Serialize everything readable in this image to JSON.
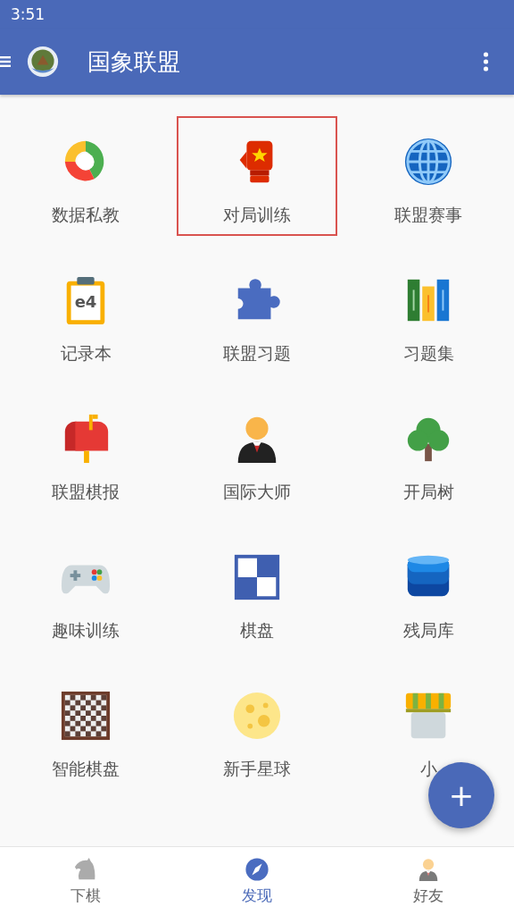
{
  "status_bar": {
    "time": "3:51"
  },
  "toolbar": {
    "title": "国象联盟"
  },
  "grid": [
    {
      "label": "数据私教",
      "kind": "donut",
      "selected": false
    },
    {
      "label": "对局训练",
      "kind": "glove",
      "selected": true
    },
    {
      "label": "联盟赛事",
      "kind": "globe",
      "selected": false
    },
    {
      "label": "记录本",
      "kind": "clipboard",
      "icon_text": "e4",
      "selected": false
    },
    {
      "label": "联盟习题",
      "kind": "puzzle",
      "selected": false
    },
    {
      "label": "习题集",
      "kind": "books",
      "selected": false
    },
    {
      "label": "联盟棋报",
      "kind": "mailbox",
      "selected": false
    },
    {
      "label": "国际大师",
      "kind": "person",
      "selected": false
    },
    {
      "label": "开局树",
      "kind": "tree",
      "selected": false
    },
    {
      "label": "趣味训练",
      "kind": "gamepad",
      "selected": false
    },
    {
      "label": "棋盘",
      "kind": "board",
      "selected": false
    },
    {
      "label": "残局库",
      "kind": "database",
      "selected": false
    },
    {
      "label": "智能棋盘",
      "kind": "checker",
      "selected": false
    },
    {
      "label": "新手星球",
      "kind": "moon",
      "selected": false
    },
    {
      "label": "小",
      "kind": "shop",
      "selected": false
    }
  ],
  "fab": {
    "symbol": "+"
  },
  "bottom_nav": [
    {
      "label": "下棋",
      "kind": "knight",
      "selected": false
    },
    {
      "label": "发现",
      "kind": "compass",
      "selected": true
    },
    {
      "label": "好友",
      "kind": "person",
      "selected": false
    }
  ]
}
